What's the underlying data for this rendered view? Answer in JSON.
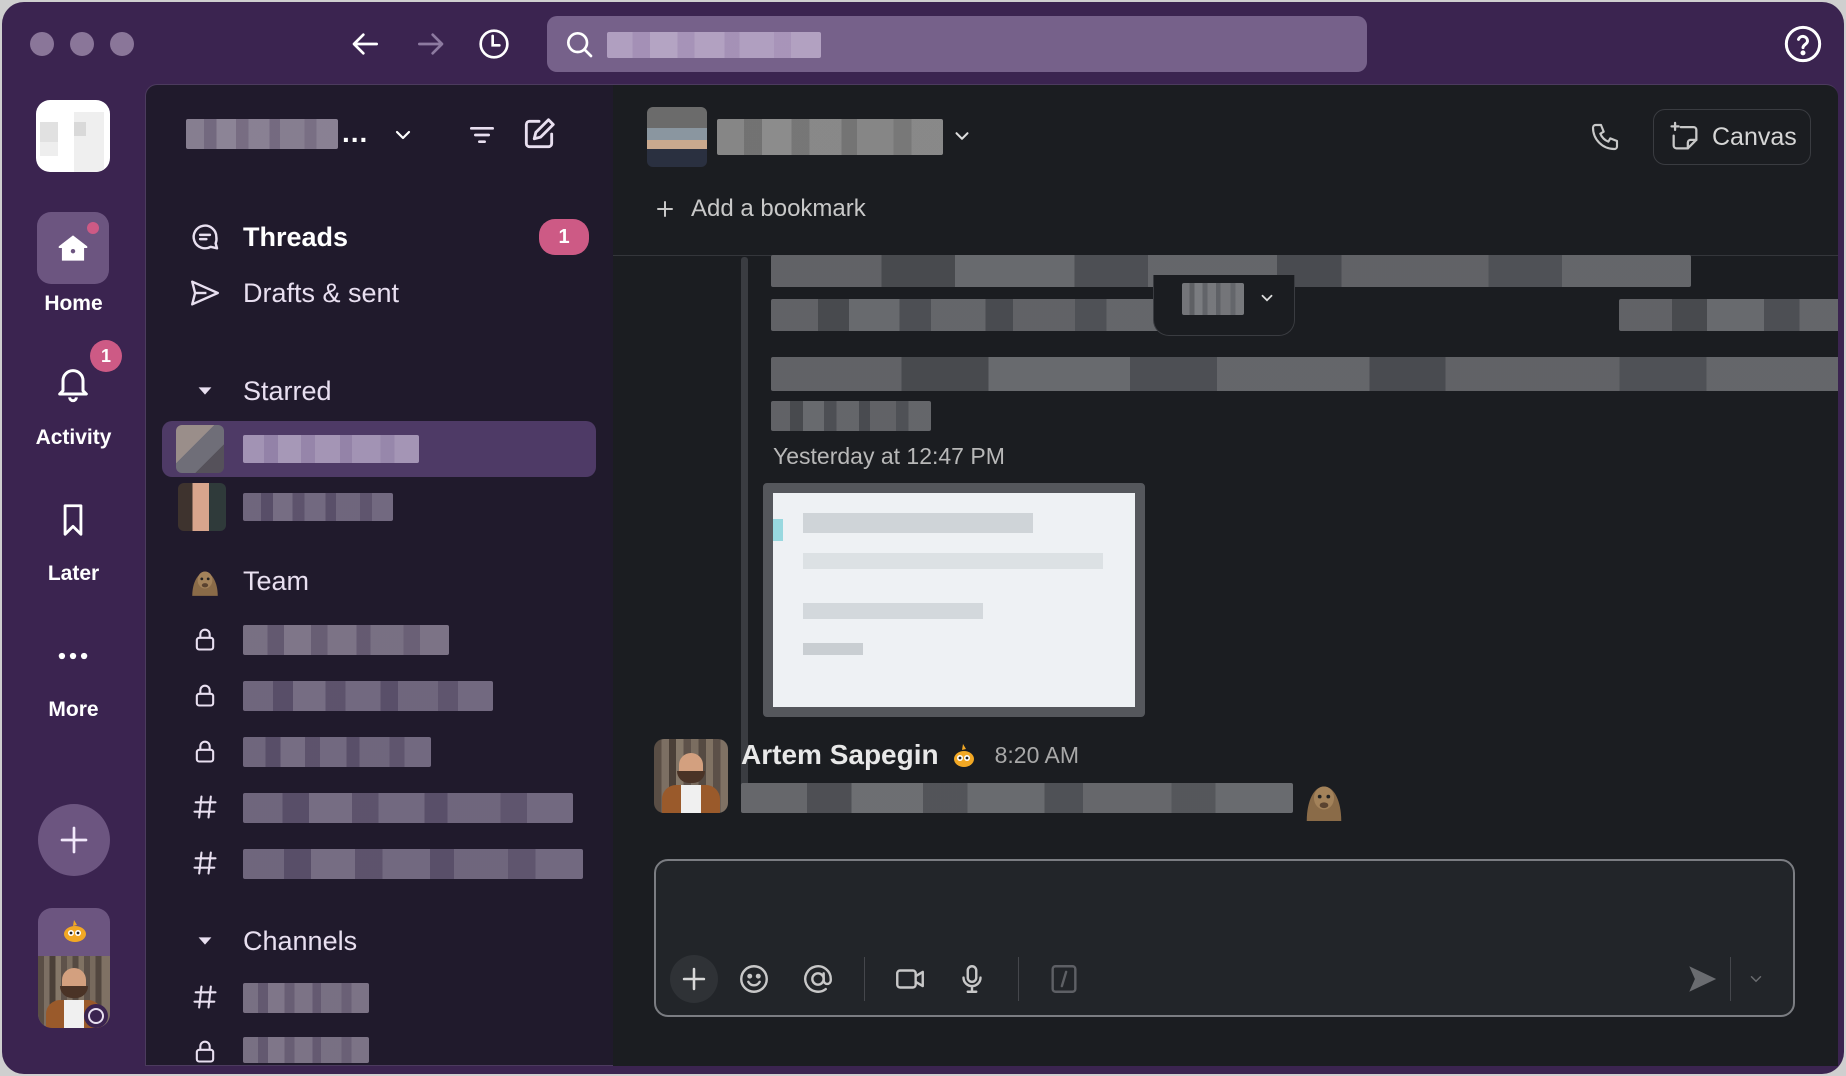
{
  "titlebar": {
    "back_label": "Back",
    "forward_label": "Forward",
    "history_label": "History",
    "search_placeholder": "Search",
    "help_label": "Help"
  },
  "rail": {
    "items": [
      {
        "label": "Home",
        "icon": "home-icon",
        "has_dot": true
      },
      {
        "label": "Activity",
        "icon": "bell-icon",
        "badge": "1"
      },
      {
        "label": "Later",
        "icon": "bookmark-icon"
      },
      {
        "label": "More",
        "icon": "more-icon"
      }
    ],
    "add_label": "Add"
  },
  "sidebar": {
    "workspace_name_ellipsis": "...",
    "threads_label": "Threads",
    "threads_badge": "1",
    "drafts_label": "Drafts & sent",
    "starred_label": "Starred",
    "team_label": "Team",
    "channels_label": "Channels",
    "sections": [
      {
        "type": "lock"
      },
      {
        "type": "lock"
      },
      {
        "type": "lock"
      },
      {
        "type": "hash"
      },
      {
        "type": "hash"
      }
    ]
  },
  "chat": {
    "bookmark_label": "Add a bookmark",
    "canvas_label": "Canvas",
    "prev_timestamp": "Yesterday at 12:47 PM",
    "message": {
      "author": "Artem Sapegin",
      "time": "8:20 AM"
    }
  },
  "composer": {
    "placeholder": ""
  },
  "colors": {
    "frame": "#3b2450",
    "sidebar_bg": "#201a2c",
    "chat_bg": "#1b1d21",
    "badge": "#cd5a85",
    "search_bg": "#76618a",
    "active_row": "#4e3a66"
  }
}
